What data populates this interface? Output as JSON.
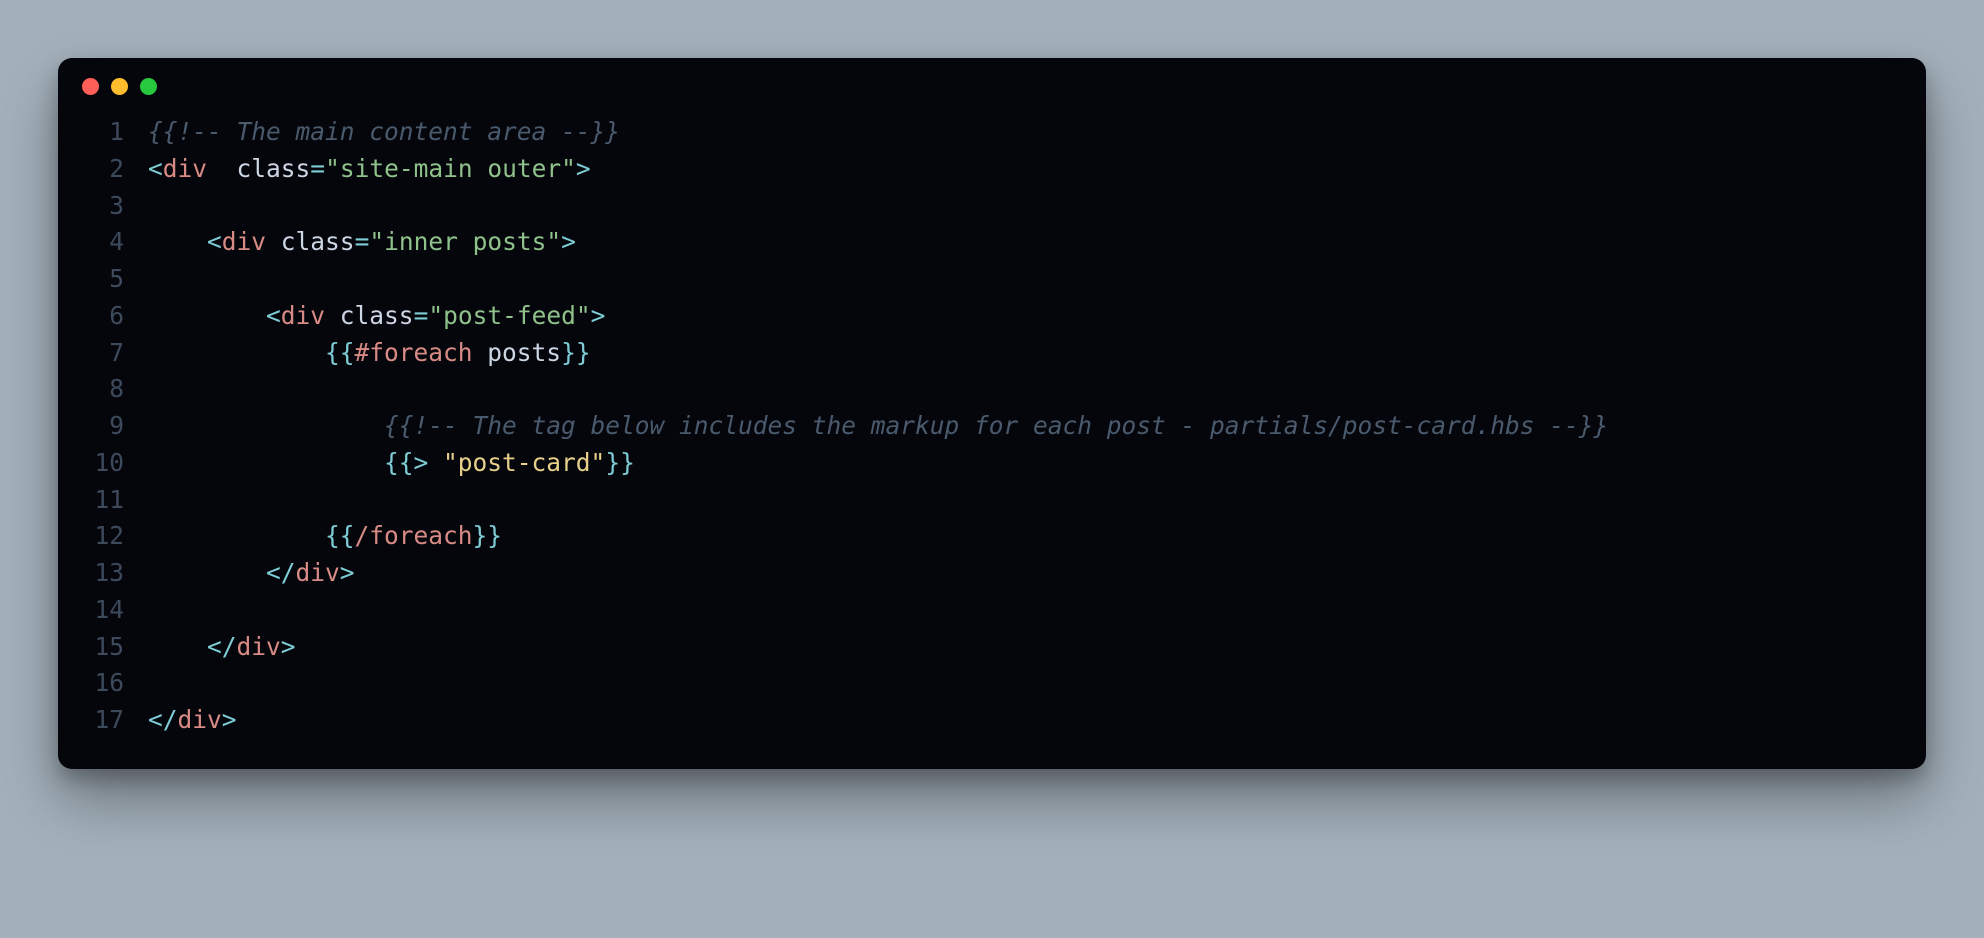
{
  "window": {
    "traffic_lights": [
      "close",
      "minimize",
      "zoom"
    ]
  },
  "code": {
    "lines": [
      {
        "n": "1",
        "indent": "",
        "tokens": [
          {
            "cls": "cmt",
            "text": "{{!-- The main content area --}}"
          }
        ]
      },
      {
        "n": "2",
        "indent": "",
        "tokens": [
          {
            "cls": "punct",
            "text": "<"
          },
          {
            "cls": "tag",
            "text": "div"
          },
          {
            "cls": "attr",
            "text": "  class"
          },
          {
            "cls": "punct",
            "text": "="
          },
          {
            "cls": "str",
            "text": "\"site-main outer\""
          },
          {
            "cls": "punct",
            "text": ">"
          }
        ]
      },
      {
        "n": "3",
        "indent": "",
        "tokens": []
      },
      {
        "n": "4",
        "indent": "    ",
        "tokens": [
          {
            "cls": "punct",
            "text": "<"
          },
          {
            "cls": "tag",
            "text": "div"
          },
          {
            "cls": "attr",
            "text": " class"
          },
          {
            "cls": "punct",
            "text": "="
          },
          {
            "cls": "str",
            "text": "\"inner posts\""
          },
          {
            "cls": "punct",
            "text": ">"
          }
        ]
      },
      {
        "n": "5",
        "indent": "",
        "tokens": []
      },
      {
        "n": "6",
        "indent": "        ",
        "tokens": [
          {
            "cls": "punct",
            "text": "<"
          },
          {
            "cls": "tag",
            "text": "div"
          },
          {
            "cls": "attr",
            "text": " class"
          },
          {
            "cls": "punct",
            "text": "="
          },
          {
            "cls": "str",
            "text": "\"post-feed\""
          },
          {
            "cls": "punct",
            "text": ">"
          }
        ]
      },
      {
        "n": "7",
        "indent": "            ",
        "tokens": [
          {
            "cls": "punct",
            "text": "{{"
          },
          {
            "cls": "hbs",
            "text": "#foreach"
          },
          {
            "cls": "ident",
            "text": " posts"
          },
          {
            "cls": "punct",
            "text": "}}"
          }
        ]
      },
      {
        "n": "8",
        "indent": "",
        "tokens": []
      },
      {
        "n": "9",
        "indent": "                ",
        "tokens": [
          {
            "cls": "cmt",
            "text": "{{!-- The tag below includes the markup for each post - partials/post-card.hbs --}}"
          }
        ]
      },
      {
        "n": "10",
        "indent": "                ",
        "tokens": [
          {
            "cls": "punct",
            "text": "{{"
          },
          {
            "cls": "punct",
            "text": "> "
          },
          {
            "cls": "part",
            "text": "\"post-card\""
          },
          {
            "cls": "punct",
            "text": "}}"
          }
        ]
      },
      {
        "n": "11",
        "indent": "",
        "tokens": []
      },
      {
        "n": "12",
        "indent": "            ",
        "tokens": [
          {
            "cls": "punct",
            "text": "{{"
          },
          {
            "cls": "hbs",
            "text": "/foreach"
          },
          {
            "cls": "punct",
            "text": "}}"
          }
        ]
      },
      {
        "n": "13",
        "indent": "        ",
        "tokens": [
          {
            "cls": "punct",
            "text": "</"
          },
          {
            "cls": "tag",
            "text": "div"
          },
          {
            "cls": "punct",
            "text": ">"
          }
        ]
      },
      {
        "n": "14",
        "indent": "",
        "tokens": []
      },
      {
        "n": "15",
        "indent": "    ",
        "tokens": [
          {
            "cls": "punct",
            "text": "</"
          },
          {
            "cls": "tag",
            "text": "div"
          },
          {
            "cls": "punct",
            "text": ">"
          }
        ]
      },
      {
        "n": "16",
        "indent": "",
        "tokens": []
      },
      {
        "n": "17",
        "indent": "",
        "tokens": [
          {
            "cls": "punct",
            "text": "</"
          },
          {
            "cls": "tag",
            "text": "div"
          },
          {
            "cls": "punct",
            "text": ">"
          }
        ]
      }
    ]
  }
}
